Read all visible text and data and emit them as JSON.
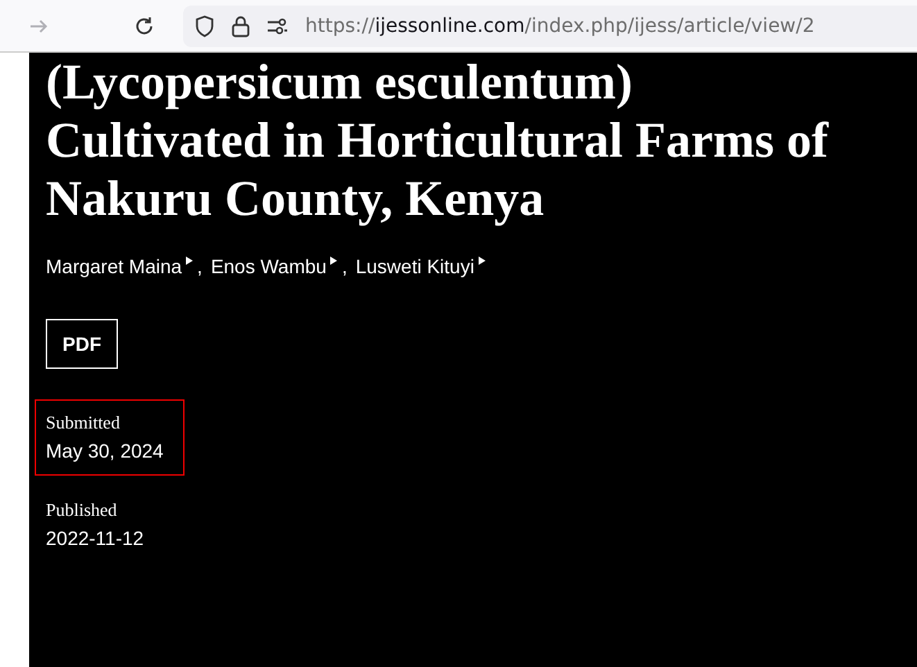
{
  "browser": {
    "url_scheme": "https://",
    "url_host": "ijessonline.com",
    "url_path": "/index.php/ijess/article/view/2"
  },
  "article": {
    "title_lines": [
      "(Lycopersicum esculentum)",
      "Cultivated in Horticultural Farms of",
      "Nakuru County, Kenya"
    ],
    "authors": [
      {
        "name": "Margaret Maina"
      },
      {
        "name": "Enos Wambu"
      },
      {
        "name": "Lusweti Kituyi"
      }
    ],
    "separator": ",",
    "galley_button": "PDF",
    "dates": [
      {
        "label": "Submitted",
        "value": "May 30, 2024",
        "selected": true
      },
      {
        "label": "Published",
        "value": "2022-11-12",
        "selected": false
      }
    ]
  }
}
